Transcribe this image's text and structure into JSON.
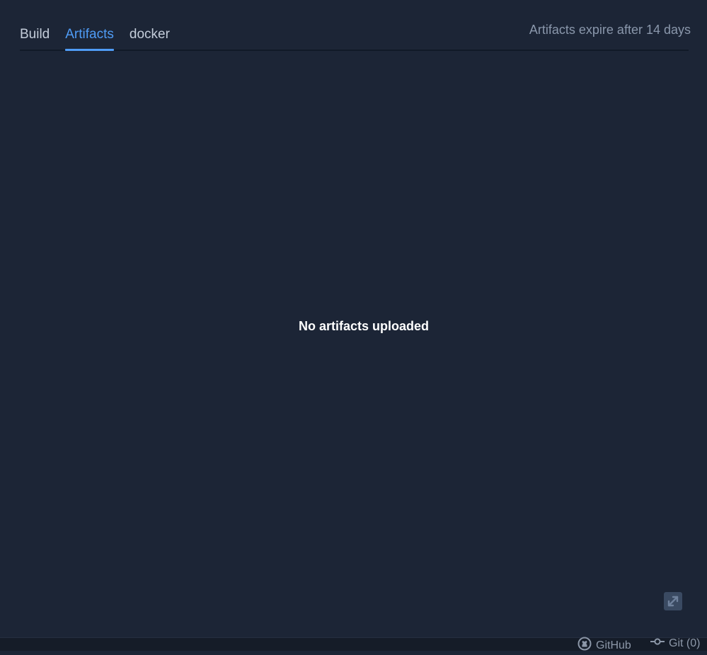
{
  "tabs": [
    {
      "label": "Build",
      "active": false
    },
    {
      "label": "Artifacts",
      "active": true
    },
    {
      "label": "docker",
      "active": false
    }
  ],
  "expire_note": "Artifacts expire after 14 days",
  "empty_state": "No artifacts uploaded",
  "statusbar": {
    "github_label": "GitHub",
    "git_label": "Git (0)"
  },
  "colors": {
    "background": "#1c2536",
    "accent": "#4f9cf6",
    "statusbar": "#151c28"
  },
  "icons": {
    "expand": "expand-diagonal-icon",
    "github": "github-icon",
    "git": "git-commit-icon"
  }
}
